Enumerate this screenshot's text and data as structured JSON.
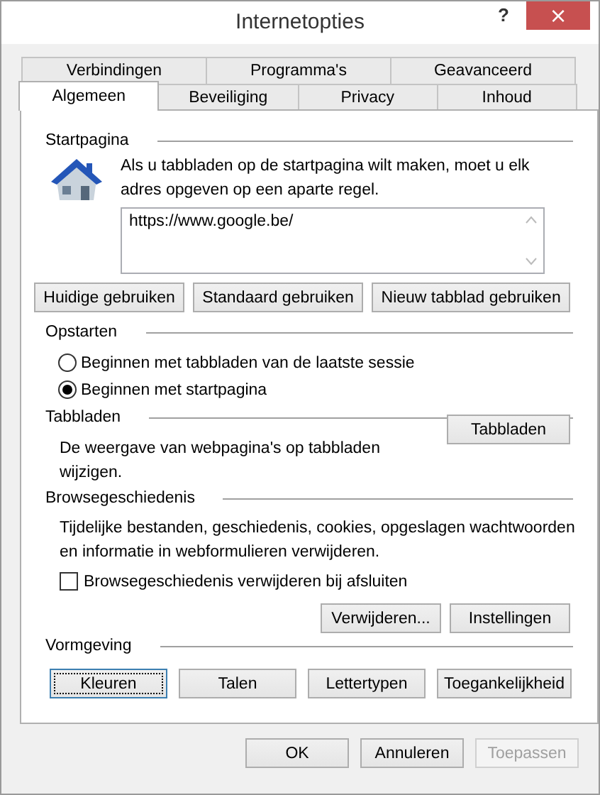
{
  "window": {
    "title": "Internetopties",
    "help": "?",
    "close": "×"
  },
  "tab_rows": [
    {
      "tabs": [
        {
          "label": "Verbindingen",
          "selected": false
        },
        {
          "label": "Programma's",
          "selected": false
        },
        {
          "label": "Geavanceerd",
          "selected": false
        }
      ]
    },
    {
      "tabs": [
        {
          "label": "Algemeen",
          "selected": true
        },
        {
          "label": "Beveiliging",
          "selected": false
        },
        {
          "label": "Privacy",
          "selected": false
        },
        {
          "label": "Inhoud",
          "selected": false
        }
      ]
    }
  ],
  "startpagina": {
    "heading": "Startpagina",
    "description": "Als u tabbladen op de startpagina wilt maken, moet u elk adres opgeven op een aparte regel.",
    "url_field": {
      "value": "https://www.google.be/"
    },
    "buttons": [
      {
        "label": "Huidige gebruiken",
        "focused": false
      },
      {
        "label": "Standaard gebruiken",
        "focused": false
      },
      {
        "label": "Nieuw tabblad gebruiken",
        "focused": false
      }
    ]
  },
  "opstarten": {
    "heading": "Opstarten",
    "options": [
      {
        "label": "Beginnen met tabbladen van de laatste sessie",
        "selected": false
      },
      {
        "label": "Beginnen met startpagina",
        "selected": true
      }
    ]
  },
  "tabbladen": {
    "heading": "Tabbladen",
    "description": "De weergave van webpagina's op tabbladen wijzigen.",
    "button": {
      "label": "Tabbladen",
      "focused": false
    }
  },
  "browsegeschiedenis": {
    "heading": "Browsegeschiedenis",
    "description": "Tijdelijke bestanden, geschiedenis, cookies, opgeslagen wachtwoorden en informatie in webformulieren verwijderen.",
    "checkbox": {
      "label": "Browsegeschiedenis verwijderen bij afsluiten",
      "checked": false
    },
    "buttons": [
      {
        "label": "Verwijderen...",
        "focused": false
      },
      {
        "label": "Instellingen",
        "focused": false
      }
    ]
  },
  "vormgeving": {
    "heading": "Vormgeving",
    "buttons": [
      {
        "label": "Kleuren",
        "focused": true
      },
      {
        "label": "Talen",
        "focused": false
      },
      {
        "label": "Lettertypen",
        "focused": false
      },
      {
        "label": "Toegankelijkheid",
        "focused": false
      }
    ]
  },
  "footer_buttons": [
    {
      "label": "OK",
      "disabled": false
    },
    {
      "label": "Annuleren",
      "disabled": false
    },
    {
      "label": "Toepassen",
      "disabled": true
    }
  ]
}
